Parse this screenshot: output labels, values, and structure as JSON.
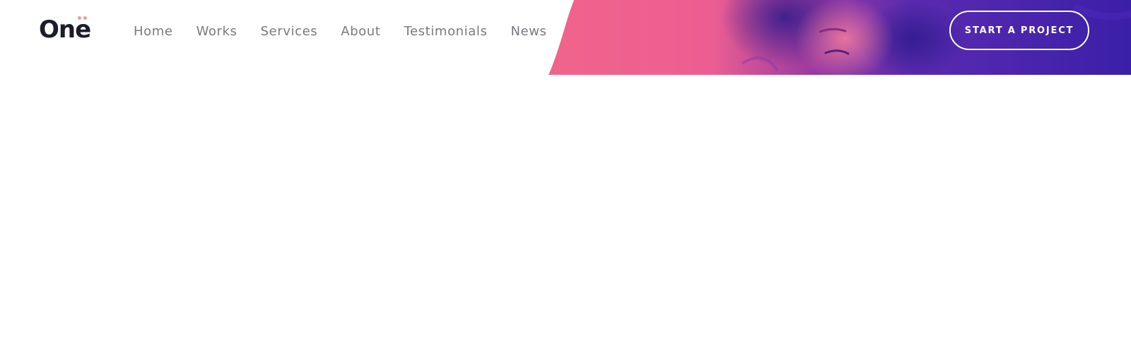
{
  "brand": {
    "logo_text": "One",
    "dot_color": "#f2998e",
    "text_color": "#1b1c2b"
  },
  "nav": {
    "items": [
      {
        "label": "Home"
      },
      {
        "label": "Works"
      },
      {
        "label": "Services"
      },
      {
        "label": "About"
      },
      {
        "label": "Testimonials"
      },
      {
        "label": "News"
      }
    ]
  },
  "header": {
    "cta_label": "START A PROJECT"
  },
  "theme": {
    "hero_pink": "#f0628e",
    "hero_purple": "#3a1fa8",
    "nav_text": "#7a7a80"
  }
}
